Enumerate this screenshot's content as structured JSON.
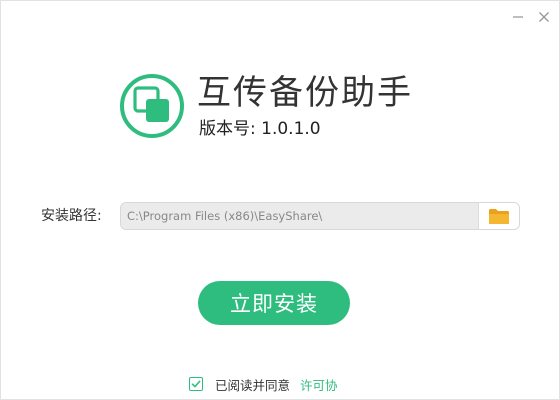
{
  "app": {
    "title": "互传备份助手",
    "version_label": "版本号: 1.0.1.0"
  },
  "install_path": {
    "label": "安装路径:",
    "value": "C:\\Program Files (x86)\\EasyShare\\"
  },
  "install_button": {
    "label": "立即安装"
  },
  "agreement": {
    "text": "已阅读并同意",
    "link": "许可协",
    "checked": true
  },
  "icons": {
    "logo": "overlapping-squares-logo",
    "browse": "folder-icon",
    "minimize": "minimize-icon",
    "close": "close-icon",
    "check": "check-icon"
  },
  "colors": {
    "accent": "#2fbd7f",
    "folder": "#f5b731",
    "path_bg": "#ebebeb",
    "path_text": "#888888"
  }
}
